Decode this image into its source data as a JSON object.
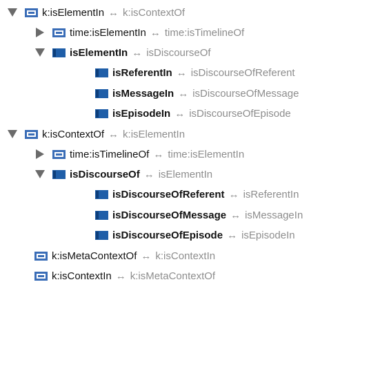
{
  "tree": {
    "rows": [
      {
        "toggle": "down",
        "icon": "annotation",
        "name": "k:isElementIn",
        "bold": false,
        "arrow": "↔",
        "inverse": "k:isContextOf"
      },
      {
        "toggle": "right",
        "icon": "annotation",
        "name": "time:isElementIn",
        "bold": false,
        "arrow": "↔",
        "inverse": "time:isTimelineOf"
      },
      {
        "toggle": "down",
        "icon": "object",
        "name": "isElementIn",
        "bold": true,
        "arrow": "↔",
        "inverse": "isDiscourseOf"
      },
      {
        "toggle": "none",
        "icon": "object",
        "name": "isReferentIn",
        "bold": true,
        "arrow": "↔",
        "inverse": "isDiscourseOfReferent"
      },
      {
        "toggle": "none",
        "icon": "object",
        "name": "isMessageIn",
        "bold": true,
        "arrow": "↔",
        "inverse": "isDiscourseOfMessage"
      },
      {
        "toggle": "none",
        "icon": "object",
        "name": "isEpisodeIn",
        "bold": true,
        "arrow": "↔",
        "inverse": "isDiscourseOfEpisode"
      },
      {
        "toggle": "down",
        "icon": "annotation",
        "name": "k:isContextOf",
        "bold": false,
        "arrow": "↔",
        "inverse": "k:isElementIn"
      },
      {
        "toggle": "right",
        "icon": "annotation",
        "name": "time:isTimelineOf",
        "bold": false,
        "arrow": "↔",
        "inverse": "time:isElementIn"
      },
      {
        "toggle": "down",
        "icon": "object",
        "name": "isDiscourseOf",
        "bold": true,
        "arrow": "↔",
        "inverse": "isElementIn"
      },
      {
        "toggle": "none",
        "icon": "object",
        "name": "isDiscourseOfReferent",
        "bold": true,
        "arrow": "↔",
        "inverse": "isReferentIn"
      },
      {
        "toggle": "none",
        "icon": "object",
        "name": "isDiscourseOfMessage",
        "bold": true,
        "arrow": "↔",
        "inverse": "isMessageIn"
      },
      {
        "toggle": "none",
        "icon": "object",
        "name": "isDiscourseOfEpisode",
        "bold": true,
        "arrow": "↔",
        "inverse": "isEpisodeIn"
      },
      {
        "toggle": "none",
        "icon": "annotation",
        "name": "k:isMetaContextOf",
        "bold": false,
        "arrow": "↔",
        "inverse": "k:isContextIn"
      },
      {
        "toggle": "none",
        "icon": "annotation",
        "name": "k:isContextIn",
        "bold": false,
        "arrow": "↔",
        "inverse": "k:isMetaContextOf"
      }
    ]
  }
}
